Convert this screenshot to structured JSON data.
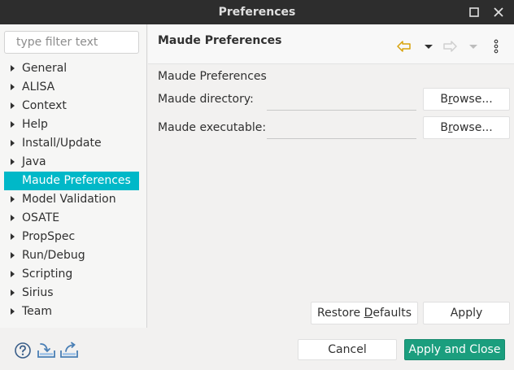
{
  "window": {
    "title": "Preferences"
  },
  "filter": {
    "placeholder": "type filter text"
  },
  "tree": [
    {
      "label": "General",
      "selected": false
    },
    {
      "label": "ALISA",
      "selected": false
    },
    {
      "label": "Context",
      "selected": false
    },
    {
      "label": "Help",
      "selected": false
    },
    {
      "label": "Install/Update",
      "selected": false
    },
    {
      "label": "Java",
      "selected": false
    },
    {
      "label": "Maude Preferences",
      "selected": true
    },
    {
      "label": "Model Validation",
      "selected": false
    },
    {
      "label": "OSATE",
      "selected": false
    },
    {
      "label": "PropSpec",
      "selected": false
    },
    {
      "label": "Run/Debug",
      "selected": false
    },
    {
      "label": "Scripting",
      "selected": false
    },
    {
      "label": "Sirius",
      "selected": false
    },
    {
      "label": "Team",
      "selected": false
    }
  ],
  "page": {
    "title": "Maude Preferences",
    "section_label": "Maude Preferences",
    "directory_label": "Maude directory:",
    "directory_value": "",
    "executable_label": "Maude executable:",
    "executable_value": "",
    "browse_label_pre": "B",
    "browse_label_ul": "r",
    "browse_label_post": "owse..."
  },
  "buttons": {
    "restore_pre": "Restore ",
    "restore_ul": "D",
    "restore_post": "efaults",
    "apply": "Apply",
    "cancel": "Cancel",
    "apply_close": "Apply and Close"
  },
  "colors": {
    "titlebar": "#2d2d2d",
    "selection": "#00b8c8",
    "primary_button": "#1b9e7e",
    "nav_arrow": "#d8a20a"
  }
}
